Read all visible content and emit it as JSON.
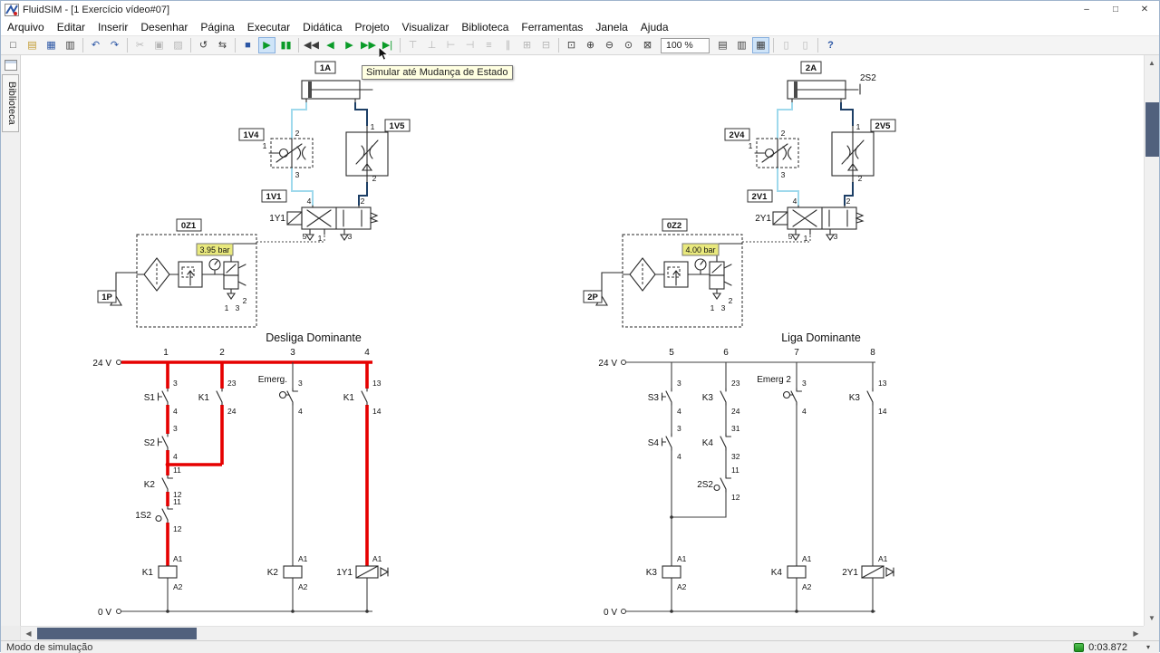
{
  "titlebar": {
    "title": "FluidSIM - [1  Exercício vídeo#07]",
    "minimize_glyph": "–",
    "maximize_glyph": "□",
    "close_glyph": "✕"
  },
  "menubar": {
    "items": [
      "Arquivo",
      "Editar",
      "Inserir",
      "Desenhar",
      "Página",
      "Executar",
      "Didática",
      "Projeto",
      "Visualizar",
      "Biblioteca",
      "Ferramentas",
      "Janela",
      "Ajuda"
    ]
  },
  "toolbar": {
    "zoom_value": "100 %",
    "tooltip": "Simular até Mudança de Estado",
    "buttons": [
      {
        "name": "new",
        "g": "□"
      },
      {
        "name": "open",
        "g": "▤"
      },
      {
        "name": "save",
        "g": "▦"
      },
      {
        "name": "print",
        "g": "▥"
      },
      {
        "name": "undo",
        "g": "↶"
      },
      {
        "name": "redo",
        "g": "↷"
      },
      {
        "name": "cut",
        "g": "✂"
      },
      {
        "name": "copy",
        "g": "▣"
      },
      {
        "name": "paste",
        "g": "▨"
      },
      {
        "name": "rotate",
        "g": "↺"
      },
      {
        "name": "mirror",
        "g": "⇆"
      },
      {
        "name": "stop",
        "g": "■"
      },
      {
        "name": "play",
        "g": "▶"
      },
      {
        "name": "pause",
        "g": "▮▮"
      },
      {
        "name": "step-start",
        "g": "◀◀"
      },
      {
        "name": "step-back",
        "g": "◀"
      },
      {
        "name": "play-until",
        "g": "▶"
      },
      {
        "name": "step-forward",
        "g": "▶▶"
      },
      {
        "name": "simulate-until-state-change",
        "g": "▶|"
      },
      {
        "name": "align-top",
        "g": "⊤"
      },
      {
        "name": "align-bottom",
        "g": "⊥"
      },
      {
        "name": "align-left",
        "g": "⊢"
      },
      {
        "name": "align-right",
        "g": "⊣"
      },
      {
        "name": "align-center-h",
        "g": "≡"
      },
      {
        "name": "align-center-v",
        "g": "∥"
      },
      {
        "name": "grid",
        "g": "⊞"
      },
      {
        "name": "frame",
        "g": "⊟"
      },
      {
        "name": "zoom-window",
        "g": "⊡"
      },
      {
        "name": "zoom-in",
        "g": "⊕"
      },
      {
        "name": "zoom-out",
        "g": "⊖"
      },
      {
        "name": "zoom-actual",
        "g": "⊙"
      },
      {
        "name": "zoom-fit",
        "g": "⊠"
      },
      {
        "name": "show-flow",
        "g": "▤"
      },
      {
        "name": "show-values",
        "g": "▥"
      },
      {
        "name": "show-path",
        "g": "▦"
      },
      {
        "name": "page-prev",
        "g": "▯"
      },
      {
        "name": "page-next",
        "g": "▯"
      },
      {
        "name": "help",
        "g": "?"
      }
    ]
  },
  "sidebar": {
    "tab": "Biblioteca"
  },
  "statusbar": {
    "mode": "Modo de simulação",
    "timer": "0:03.872",
    "caret": "▾"
  },
  "pneu_left": {
    "cyl": "1A",
    "v4": "1V4",
    "v5": "1V5",
    "v1": "1V1",
    "sol": "1Y1",
    "unit": "0Z1",
    "src": "1P",
    "pressure": "3.95 bar",
    "ports": {
      "v1a": "4",
      "v1b": "2",
      "p5": "5",
      "p1": "1",
      "p3": "3",
      "v4t": "2",
      "v4l": "1",
      "v4b": "3",
      "v5t": "1",
      "v5b": "2",
      "u1": "1",
      "u3": "3",
      "u2": "2"
    }
  },
  "pneu_right": {
    "cyl": "2A",
    "sensor": "2S2",
    "v4": "2V4",
    "v5": "2V5",
    "v1": "2V1",
    "sol": "2Y1",
    "unit": "0Z2",
    "src": "2P",
    "pressure": "4.00 bar",
    "ports": {
      "v1a": "4",
      "v1b": "2",
      "p5": "5",
      "p1": "1",
      "p3": "3",
      "v4t": "2",
      "v4l": "1",
      "v4b": "3",
      "v5t": "1",
      "v5b": "2",
      "u1": "1",
      "u3": "3",
      "u2": "2"
    }
  },
  "ladder_left": {
    "title": "Desliga Dominante",
    "v_plus": "24 V",
    "v_zero": "0 V",
    "cols": [
      "1",
      "2",
      "3",
      "4"
    ],
    "s1": {
      "l": "S1",
      "a": "3",
      "b": "4"
    },
    "s2": {
      "l": "S2",
      "a": "3",
      "b": "4"
    },
    "k2no": {
      "l": "K2",
      "a": "11",
      "b": "12"
    },
    "s12": {
      "l": "1S2",
      "a": "11",
      "b": "12"
    },
    "k1coil": {
      "l": "K1",
      "a": "A1",
      "b": "A2"
    },
    "k1c2": {
      "l": "K1",
      "a": "23",
      "b": "24"
    },
    "emerg": {
      "l": "Emerg.",
      "a": "3",
      "b": "4"
    },
    "k2coil": {
      "l": "K2",
      "a": "A1",
      "b": "A2"
    },
    "k1c4": {
      "l": "K1",
      "a": "13",
      "b": "14"
    },
    "y1": {
      "l": "1Y1",
      "a": "A1"
    }
  },
  "ladder_right": {
    "title": "Liga Dominante",
    "v_plus": "24 V",
    "v_zero": "0 V",
    "cols": [
      "5",
      "6",
      "7",
      "8"
    ],
    "s3": {
      "l": "S3",
      "a": "3",
      "b": "4"
    },
    "s4": {
      "l": "S4",
      "a": "3",
      "b": "4"
    },
    "k3c6": {
      "l": "K3",
      "a": "23",
      "b": "24"
    },
    "k4nc": {
      "l": "K4",
      "a": "31",
      "b": "32"
    },
    "s22": {
      "l": "2S2",
      "a": "11",
      "b": "12"
    },
    "k3coil": {
      "l": "K3",
      "a": "A1",
      "b": "A2"
    },
    "emerg2": {
      "l": "Emerg 2",
      "a": "3",
      "b": "4"
    },
    "k4coil": {
      "l": "K4",
      "a": "A1",
      "b": "A2"
    },
    "k3c8": {
      "l": "K3",
      "a": "13",
      "b": "14"
    },
    "y2": {
      "l": "2Y1",
      "a": "A1"
    }
  },
  "colors": {
    "energized": "#e60000",
    "pressure_line": "#1d3f66",
    "exhaust_line": "#9fd9ec",
    "badge_bg": "#e9e97d"
  }
}
